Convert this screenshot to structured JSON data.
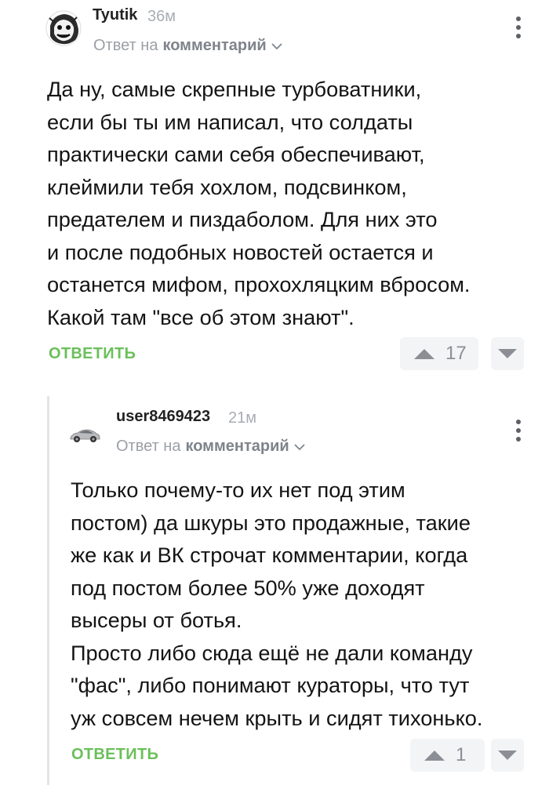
{
  "comments": [
    {
      "username": "Tyutik",
      "time": "36м",
      "reply_to_prefix": "Ответ на",
      "reply_to_target": "комментарий",
      "text": "Да ну, самые скрепные турбоватники,\nесли бы ты им написал, что солдаты\nпрактически сами себя обеспечивают,\nклеймили тебя хохлом, подсвинком,\nпредателем и пиздаболом. Для них это\nи после подобных новостей остается и\nостанется мифом, прохохляцким вбросом.\nКакой там \"все об этом знают\".",
      "reply_label": "ОТВЕТИТЬ",
      "rating": "17",
      "avatar_icon": "meme-face-avatar-icon"
    },
    {
      "username": "user8469423",
      "time": "21м",
      "reply_to_prefix": "Ответ на",
      "reply_to_target": "комментарий",
      "text": "Только почему-то их нет под этим\nпостом) да шкуры это продажные, такие\nже как и ВК строчат комментарии, когда\nпод постом более 50% уже доходят\nвысеры от ботья.\nПросто либо сюда ещё не дали команду\n\"фас\", либо понимают кураторы, что тут\nуж совсем нечем крыть и сидят тихонько.",
      "reply_label": "ОТВЕТИТЬ",
      "rating": "1",
      "avatar_icon": "car-avatar-icon"
    }
  ],
  "colors": {
    "reply_green": "#6bbf5a",
    "muted_gray": "#9ba0a6",
    "vote_bg": "#f3f4f6"
  }
}
